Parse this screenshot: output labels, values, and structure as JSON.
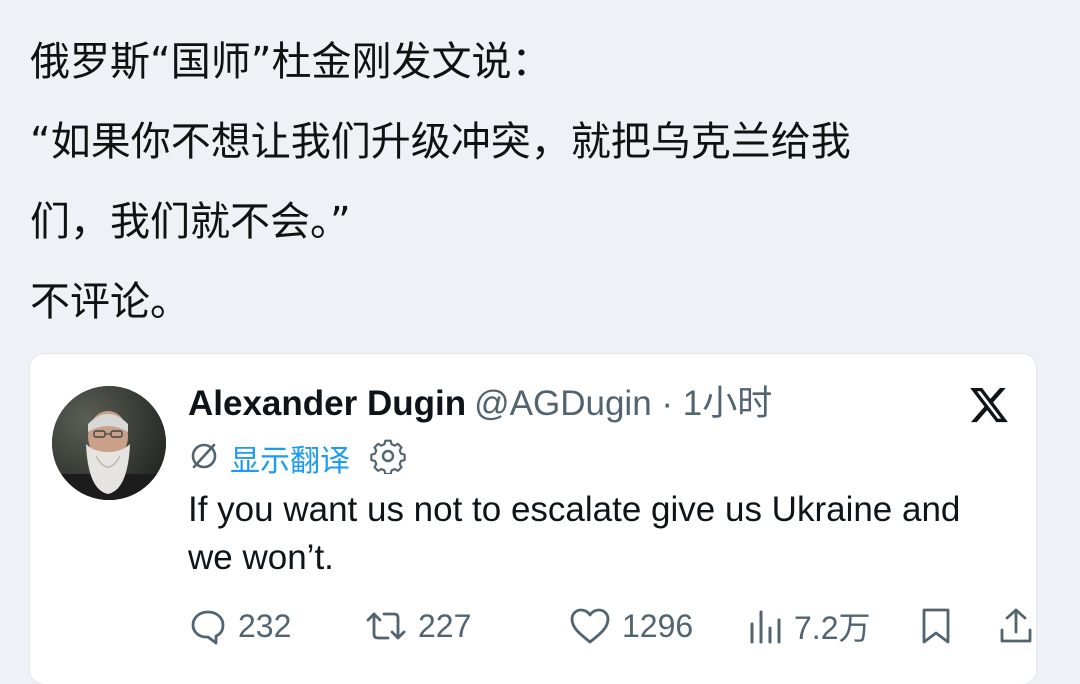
{
  "post": {
    "lines": [
      "俄罗斯“国师”杜金刚发文说：",
      "“如果你不想让我们升级冲突，就把乌克兰给我",
      "们，我们就不会。”",
      "不评论。"
    ]
  },
  "tweet": {
    "author_name": "Alexander Dugin",
    "author_meta": "@AGDugin · 1小时",
    "translate_label": "显示翻译",
    "body": "If you want us not to escalate give us Ukraine and we won’t.",
    "stats": {
      "replies": "232",
      "reposts": "227",
      "likes": "1296",
      "views": "7.2万"
    }
  },
  "icons": {
    "brand": "x-logo",
    "translate": "translate-slash-icon",
    "settings": "gear-icon",
    "reply": "reply-icon",
    "repost": "repost-icon",
    "like": "heart-icon",
    "views": "analytics-icon",
    "bookmark": "bookmark-icon",
    "share": "share-icon"
  },
  "colors": {
    "page_background": "#f0f1f6",
    "card_background": "#ffffff",
    "link_blue": "#1d9bf0",
    "secondary_text": "#536471",
    "primary_text": "#0f1419"
  }
}
